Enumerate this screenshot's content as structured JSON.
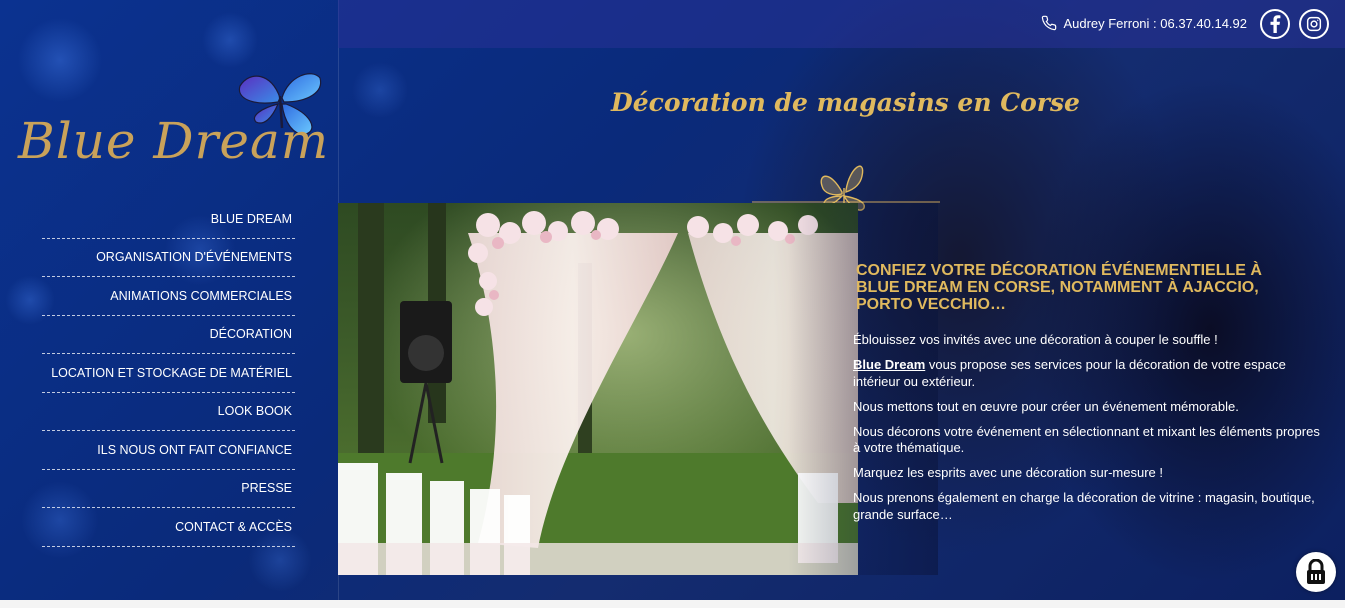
{
  "header": {
    "contact_text": "Audrey Ferroni : 06.37.40.14.92",
    "phone_icon": "phone-icon",
    "social": [
      {
        "name": "facebook",
        "icon": "facebook-icon"
      },
      {
        "name": "instagram",
        "icon": "instagram-icon"
      }
    ]
  },
  "logo": {
    "text": "Blue Dream",
    "icon": "butterfly-icon"
  },
  "nav": {
    "items": [
      {
        "label": "BLUE DREAM"
      },
      {
        "label": "ORGANISATION D'ÉVÉNEMENTS"
      },
      {
        "label": "ANIMATIONS COMMERCIALES"
      },
      {
        "label": "DÉCORATION"
      },
      {
        "label": "LOCATION ET STOCKAGE DE MATÉRIEL"
      },
      {
        "label": "LOOK BOOK"
      },
      {
        "label": "ILS NOUS ONT FAIT CONFIANCE"
      },
      {
        "label": "PRESSE"
      },
      {
        "label": "CONTACT & ACCÈS"
      }
    ]
  },
  "main": {
    "title": "Décoration de magasins en Corse",
    "subtitle": "Confiez votre décoration événementielle à Blue Dream en Corse, notamment à Ajaccio, Porto Vecchio…",
    "paragraphs": {
      "p1": "Éblouissez vos invités avec une décoration à couper le souffle !",
      "p2_link": "Blue Dream",
      "p2_rest": " vous propose ses services pour la décoration de votre espace intérieur ou extérieur.",
      "p3": "Nous mettons tout en œuvre pour créer un événement mémorable.",
      "p4": "Nous décorons votre événement en sélectionnant et mixant les éléments propres à votre thématique.",
      "p5": "Marquez les esprits avec une décoration sur-mesure !",
      "p6": "Nous prenons également en charge la décoration de vitrine : magasin, boutique, grande surface…"
    }
  },
  "colors": {
    "gold": "#e0b95e",
    "navy": "#0a2a7a"
  }
}
